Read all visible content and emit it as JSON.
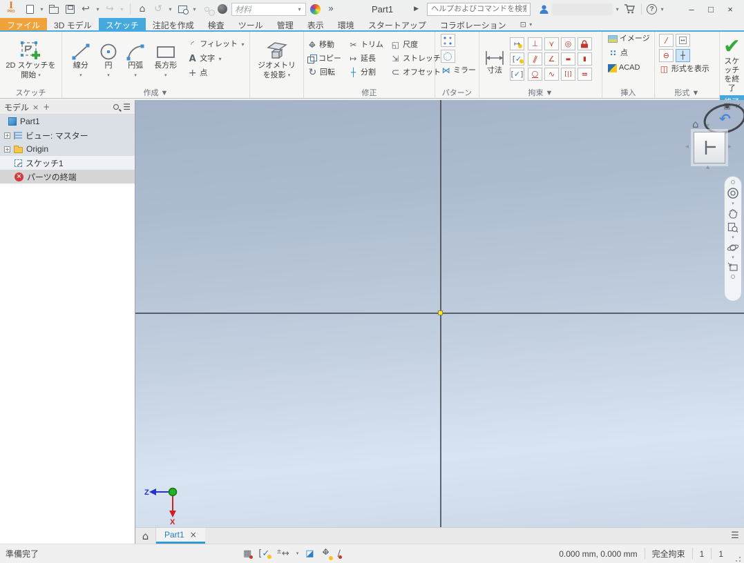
{
  "titlebar": {
    "logo": "I",
    "logo_sub": "PRO",
    "material_value": "材料",
    "doc_title": "Part1",
    "search_placeholder": "ヘルプおよびコマンドを検索...",
    "help": "?"
  },
  "window_controls": {
    "minimize": "–",
    "maximize": "□",
    "close": "×"
  },
  "ribbon_tabs": [
    {
      "label": "ファイル"
    },
    {
      "label": "3D モデル"
    },
    {
      "label": "スケッチ"
    },
    {
      "label": "注記を作成"
    },
    {
      "label": "検査"
    },
    {
      "label": "ツール"
    },
    {
      "label": "管理"
    },
    {
      "label": "表示"
    },
    {
      "label": "環境"
    },
    {
      "label": "スタートアップ"
    },
    {
      "label": "コラボレーション"
    }
  ],
  "ribbon": {
    "sketch": {
      "line1": "2D スケッチを",
      "line2": "開始",
      "panel_label": "スケッチ"
    },
    "create": {
      "line": "線分",
      "circle": "円",
      "arc": "円弧",
      "rect": "長方形",
      "fillet": "フィレット",
      "text": "文字",
      "point": "点",
      "panel_label": "作成 ▼"
    },
    "project": {
      "line1": "ジオメトリ",
      "line2": "を投影"
    },
    "modify": {
      "items": [
        "移動",
        "トリム",
        "尺度",
        "コピー",
        "延長",
        "ストレッチ",
        "回転",
        "分割",
        "オフセット"
      ],
      "panel_label": "修正"
    },
    "pattern": {
      "mirror": "ミラー",
      "panel_label": "パターン"
    },
    "constrain": {
      "dimension": "寸法",
      "panel_label": "拘束 ▼"
    },
    "insert": {
      "image": "イメージ",
      "point": "点",
      "acad": "ACAD",
      "panel_label": "挿入"
    },
    "format": {
      "show": "形式を表示",
      "panel_label": "形式 ▼"
    },
    "finish": {
      "line1": "スケッチ",
      "line2": "を終了",
      "panel_label": "終了"
    }
  },
  "browser": {
    "tab": "モデル",
    "items": [
      {
        "label": "Part1"
      },
      {
        "label": "ビュー: マスター"
      },
      {
        "label": "Origin"
      },
      {
        "label": "スケッチ1"
      },
      {
        "label": "パーツの終端"
      }
    ]
  },
  "viewport": {
    "z": "Z",
    "x": "X"
  },
  "doc_tabs": {
    "active": "Part1"
  },
  "statusbar": {
    "ready": "準備完了",
    "coords": "0.000 mm, 0.000 mm",
    "constraint": "完全拘束",
    "count1": "1",
    "count2": "1"
  },
  "colors": {
    "accent": "#45a9de",
    "file_tab": "#f0a33b",
    "finish_green": "#3cb043",
    "constraint_red": "#c0392b"
  },
  "icons": {
    "dropdown": "▾",
    "home": "⌂",
    "undo": "↩",
    "redo": "↪",
    "return": "↺",
    "expand": "»",
    "forward": "▶",
    "menu": "☰",
    "plus": "+",
    "close": "×",
    "ribbon_toggle": "⊡",
    "perpendicular": "⊥",
    "coincident": "⋎",
    "concentric": "◎",
    "parallel": "∥",
    "collinear": "∠",
    "horizontal": "▬",
    "vertical": "▮",
    "tangent": "○",
    "smooth": "∿",
    "symmetric": "[|]",
    "equal": "=",
    "trim": "✂",
    "scale": "◱",
    "extend": "↦",
    "stretch": "⇲",
    "rotate": "↻",
    "split": "┼",
    "offset": "⊂",
    "mirror": "⋈",
    "fillet": "◜",
    "text": "A",
    "point": "+",
    "insert_point": "∷",
    "construction": "∕",
    "centerline": "⊖",
    "centerpoint": "┼",
    "show_format": "◫",
    "driven": "↔",
    "restore": "▣",
    "orbit_back": "↶",
    "tri_up": "▴",
    "tri_down": "▾",
    "tri_left": "◂",
    "tri_right": "▸",
    "arrow_h": "↔",
    "arrow_v": "↕",
    "check": "✔",
    "grid": "▦",
    "slice": "◪",
    "small_check": "✓",
    "bracket": "[",
    "pm": "±",
    "slash": "∕"
  }
}
